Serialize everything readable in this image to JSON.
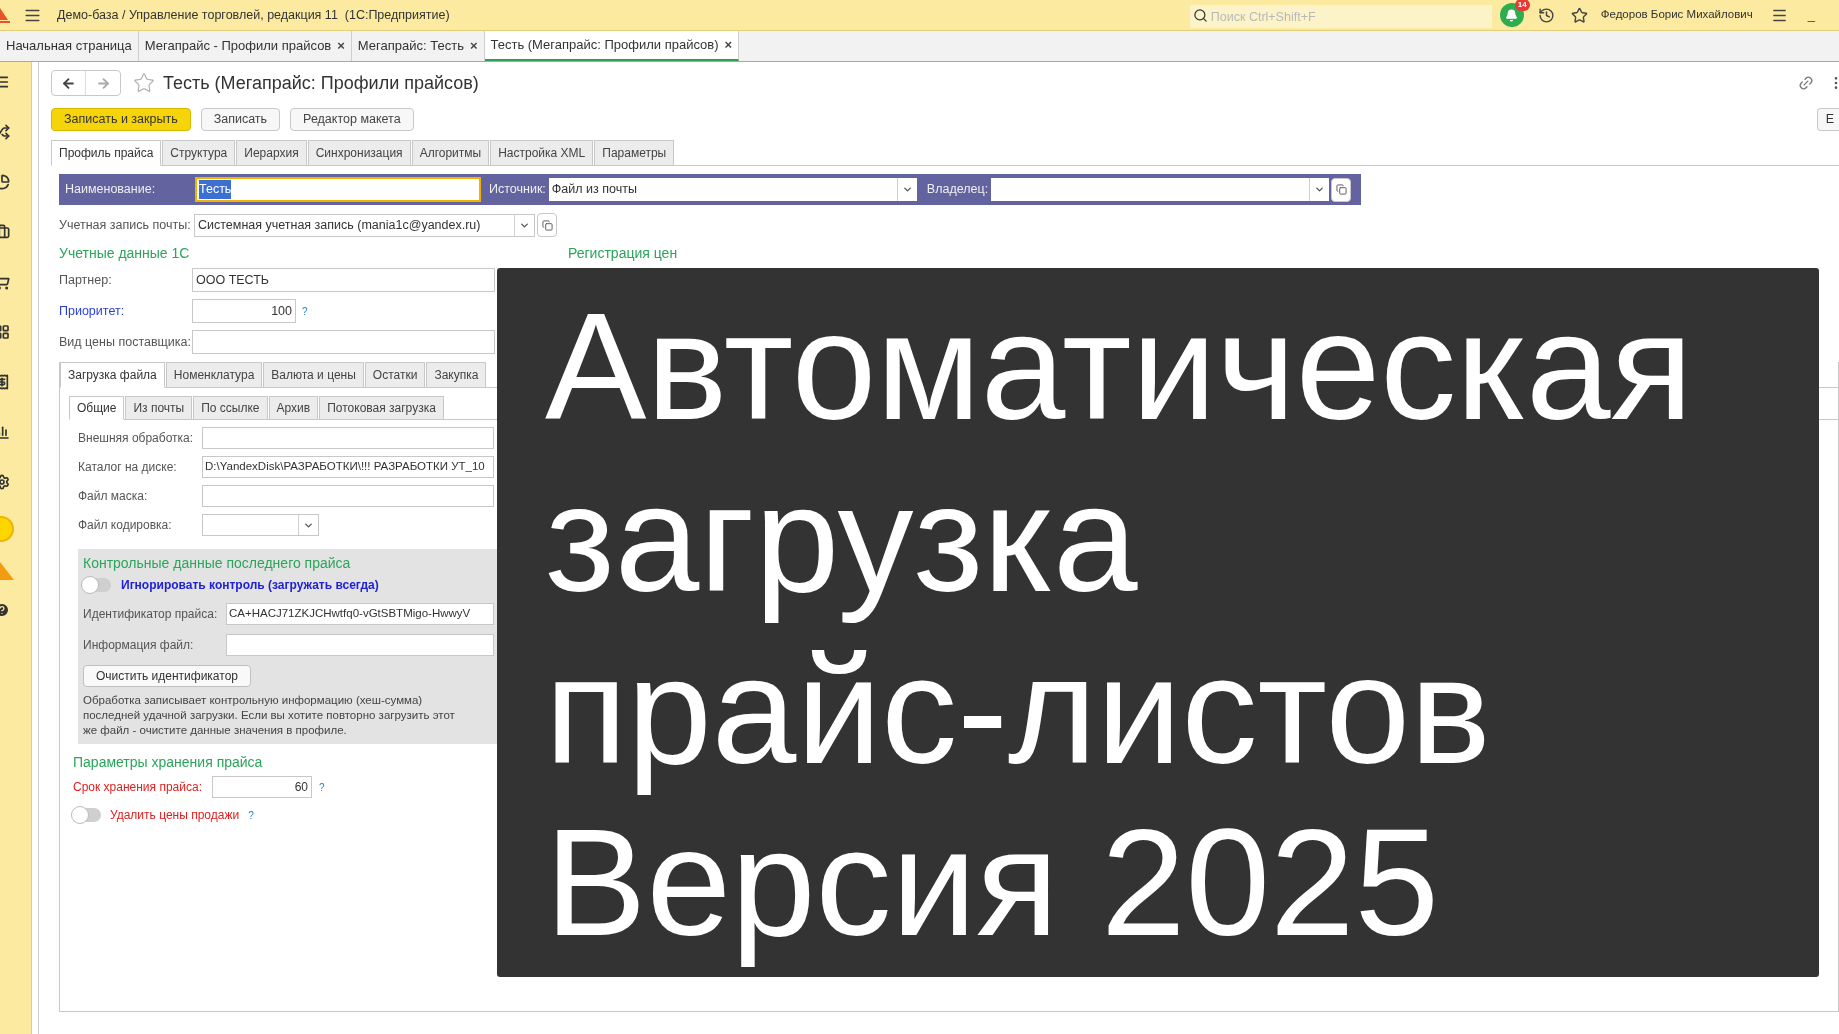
{
  "window": {
    "title": "Демо-база / Управление торговлей, редакция 11  (1С:Предприятие)",
    "search": {
      "placeholder": "Поиск Ctrl+Shift+F"
    },
    "notifications": "14",
    "user": "Федоров Борис Михайлович",
    "minimize": "_"
  },
  "open_tabs": [
    {
      "label": "Начальная страница",
      "selected": false
    },
    {
      "label": "Мегапрайс - Профили прайсов",
      "close": "×",
      "selected": false
    },
    {
      "label": "Мегапрайс: Тесть",
      "close": "×",
      "selected": false
    },
    {
      "label": "Тесть (Мегапрайс: Профили прайсов)",
      "close": "×",
      "selected": true
    }
  ],
  "document": {
    "title": "Тесть (Мегапрайс: Профили прайсов)",
    "buttons": [
      {
        "label": "Записать и закрыть",
        "kind": "primary"
      },
      {
        "label": "Записать",
        "kind": "normal"
      },
      {
        "label": "Редактор макета",
        "kind": "normal"
      }
    ],
    "edge_button": "Е"
  },
  "form_tabs": [
    {
      "label": "Профиль прайса",
      "selected": true
    },
    {
      "label": "Структура",
      "selected": false
    },
    {
      "label": "Иерархия",
      "selected": false
    },
    {
      "label": "Синхронизация",
      "selected": false
    },
    {
      "label": "Алгоритмы",
      "selected": false
    },
    {
      "label": "Настройка XML",
      "selected": false
    },
    {
      "label": "Параметры",
      "selected": false
    }
  ],
  "header_band": {
    "name": {
      "label": "Наименование:",
      "value": "Тесть"
    },
    "source": {
      "label": "Источник:",
      "value": "Файл из почты"
    },
    "owner": {
      "label": "Владелец:"
    }
  },
  "mail_account": {
    "label": "Учетная запись почты:",
    "value": "Системная учетная запись (mania1c@yandex.ru)"
  },
  "section_1c": {
    "title": "Учетные данные 1С",
    "partner": {
      "label": "Партнер:",
      "value": "ООО ТЕСТЬ"
    },
    "priority": {
      "label": "Приоритет:",
      "value": "100",
      "help": "?"
    },
    "supplier_price": {
      "label": "Вид цены поставщика:"
    }
  },
  "section_prices": {
    "title": "Регистрация цен"
  },
  "inner_tabs": [
    {
      "label": "Загрузка файла",
      "selected": true
    },
    {
      "label": "Номенклатура",
      "selected": false
    },
    {
      "label": "Валюта и цены",
      "selected": false
    },
    {
      "label": "Остатки",
      "selected": false
    },
    {
      "label": "Закупка",
      "selected": false
    }
  ],
  "sub_tabs": [
    {
      "label": "Общие",
      "selected": true
    },
    {
      "label": "Из почты",
      "selected": false
    },
    {
      "label": "По ссылке",
      "selected": false
    },
    {
      "label": "Архив",
      "selected": false
    },
    {
      "label": "Потоковая загрузка",
      "selected": false
    }
  ],
  "file_fields": [
    {
      "label": "Внешняя обработка:",
      "kind": "select"
    },
    {
      "label": "Каталог на диске:",
      "value": "D:\\YandexDisk\\РАЗРАБОТКИ\\!!! РАЗРАБОТКИ УТ_10",
      "kind": "text"
    },
    {
      "label": "Файл маска:",
      "kind": "text"
    },
    {
      "label": "Файл кодировка:",
      "kind": "short_select"
    }
  ],
  "control_panel": {
    "title": "Контрольные данные последнего прайса",
    "ignore": {
      "label": "Игнорировать контроль (загружать всегда)",
      "on": false
    },
    "price_id": {
      "label": "Идентификатор прайса:",
      "value": "CA+HACJ71ZKJCHwtfq0-vGtSBTMigo-HwwyV"
    },
    "file_info": {
      "label": "Информация файл:"
    },
    "clear_button": "Очистить идентификатор",
    "note": "Обработка записывает контрольную информацию (хеш-сумма) последней удачной загрузки. Если вы хотите повторно загрузить этот же файл - очистите данные значения в профиле."
  },
  "storage": {
    "title": "Параметры хранения прайса",
    "term": {
      "label": "Срок хранения прайса:",
      "value": "60",
      "help": "?"
    },
    "delete_prices": {
      "label": "Удалить цены продажи",
      "on": false,
      "help": "?"
    }
  },
  "banner": {
    "lines": [
      "Автоматическая",
      "загрузка",
      "прайс-листов",
      "Версия 2025"
    ]
  }
}
